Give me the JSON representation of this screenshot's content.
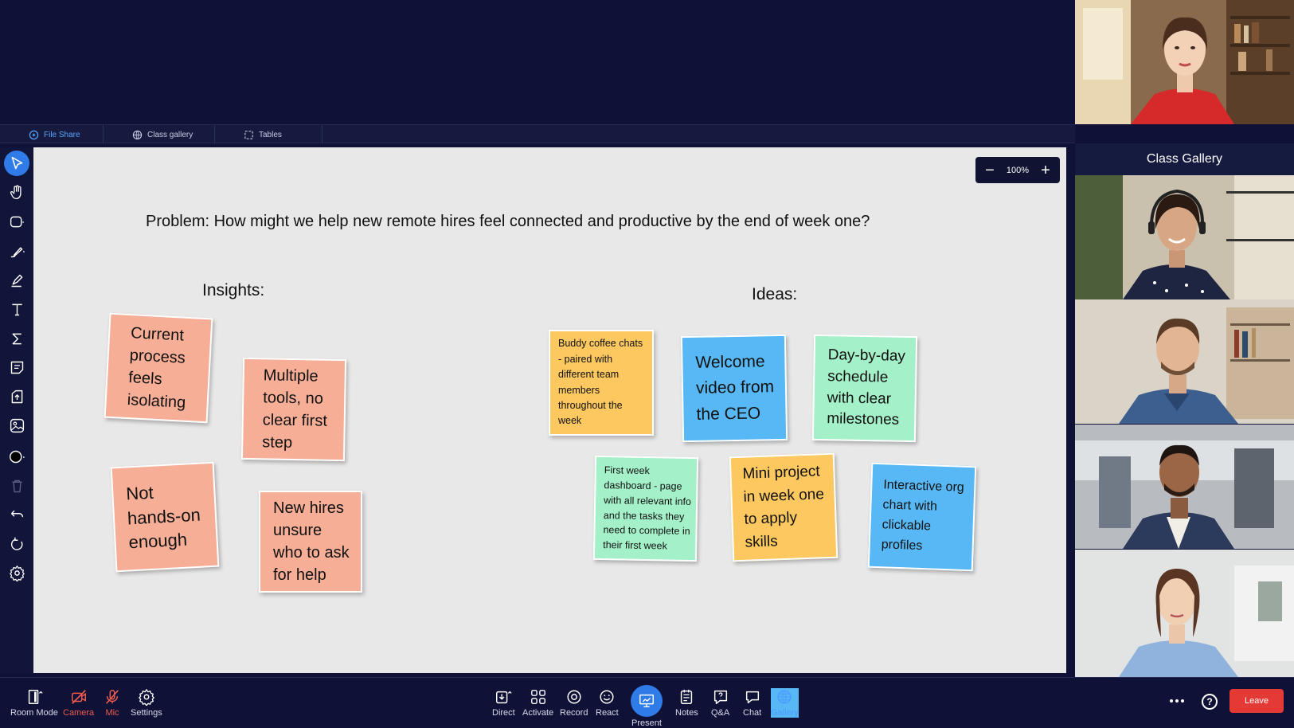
{
  "tabs": [
    {
      "label": "File Share",
      "icon": "file-share-icon",
      "active": true
    },
    {
      "label": "Class gallery",
      "icon": "globe-icon",
      "active": false
    },
    {
      "label": "Tables",
      "icon": "tables-icon",
      "active": false
    }
  ],
  "toolbar": {
    "tools": [
      "select-tool",
      "pan-tool",
      "shape-tool",
      "pen-tool",
      "highlighter-tool",
      "text-tool",
      "equation-tool",
      "sticky-note-tool",
      "upload-tool",
      "image-tool",
      "color-tool",
      "delete-tool",
      "undo-tool",
      "redo-tool",
      "settings-tool"
    ]
  },
  "canvas": {
    "zoom": {
      "value": "100%",
      "minus": "−",
      "plus": "+"
    },
    "problem": "Problem: How might we help new remote hires feel connected and productive by the end of week one?",
    "insights_heading": "Insights:",
    "ideas_heading": "Ideas:",
    "insights": [
      {
        "text": "Current process feels isolating",
        "color": "#f7ae96"
      },
      {
        "text": "Multiple tools, no clear first step",
        "color": "#f7ae96"
      },
      {
        "text": "Not hands-on enough",
        "color": "#f7ae96"
      },
      {
        "text": "New hires unsure who to ask for help",
        "color": "#f7ae96"
      }
    ],
    "ideas": [
      {
        "text": "Buddy coffee chats - paired with different team members throughout the week",
        "color": "#fcc85f"
      },
      {
        "text": "Welcome video from the CEO",
        "color": "#57b8f5"
      },
      {
        "text": "Day-by-day schedule with clear milestones",
        "color": "#a4f0c8"
      },
      {
        "text": "First week dashboard - page with all relevant info and the tasks they need to complete in their first week",
        "color": "#a4f0c8"
      },
      {
        "text": "Mini project in week one to apply skills",
        "color": "#fcc85f"
      },
      {
        "text": "Interactive org chart with clickable profiles",
        "color": "#57b8f5"
      }
    ]
  },
  "right_panel": {
    "gallery_title": "Class Gallery"
  },
  "bottom_bar": {
    "left": [
      {
        "label": "Room Mode",
        "icon": "room-mode-icon"
      },
      {
        "label": "Camera",
        "icon": "camera-off-icon",
        "state": "off"
      },
      {
        "label": "Mic",
        "icon": "mic-off-icon",
        "state": "off"
      },
      {
        "label": "Settings",
        "icon": "gear-icon"
      }
    ],
    "center": [
      {
        "label": "Direct",
        "icon": "direct-icon"
      },
      {
        "label": "Activate",
        "icon": "activate-icon"
      },
      {
        "label": "Record",
        "icon": "record-icon"
      },
      {
        "label": "React",
        "icon": "smiley-icon"
      },
      {
        "label": "Present",
        "icon": "present-icon"
      },
      {
        "label": "Notes",
        "icon": "notes-icon"
      },
      {
        "label": "Q&A",
        "icon": "qa-icon"
      },
      {
        "label": "Chat",
        "icon": "chat-icon"
      },
      {
        "label": "Gallery",
        "icon": "gallery-globe-icon",
        "active": true
      }
    ],
    "leave_label": "Leave",
    "help_label": "?"
  },
  "colors": {
    "accent": "#2f7be8",
    "leave": "#e53935",
    "muted_red": "#ef5b4e",
    "background": "#0f1136"
  }
}
